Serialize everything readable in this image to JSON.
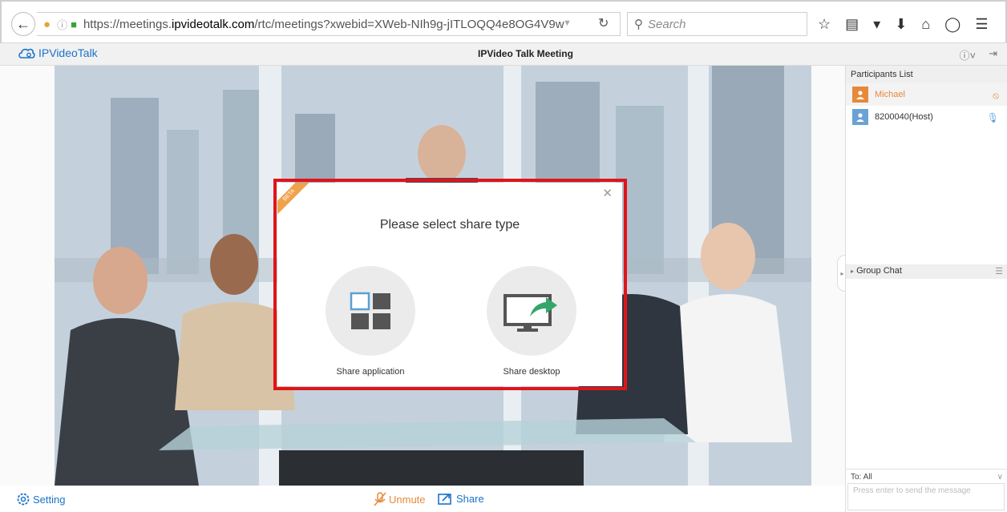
{
  "browser": {
    "url_prefix": "https://meetings.",
    "url_host": "ipvideotalk.com",
    "url_path": "/rtc/meetings?xwebid=XWeb-NIh9g-jITLOQQ4e8OG4V9w",
    "search_placeholder": "Search"
  },
  "app": {
    "logo_text": "IPVideoTalk",
    "title": "IPVideo Talk Meeting"
  },
  "dialog": {
    "badge": "BETA",
    "title": "Please select share type",
    "option_app": "Share application",
    "option_desktop": "Share desktop"
  },
  "bottom": {
    "setting": "Setting",
    "unmute": "Unmute",
    "share": "Share"
  },
  "sidebar": {
    "participants_title": "Participants List",
    "participants": [
      {
        "name": "Michael",
        "color": "#e7893a"
      },
      {
        "name": "8200040(Host)",
        "color": "#333333"
      }
    ],
    "chat_title": "Group Chat",
    "to_label": "To: All",
    "message_placeholder": "Press enter to send the message"
  }
}
